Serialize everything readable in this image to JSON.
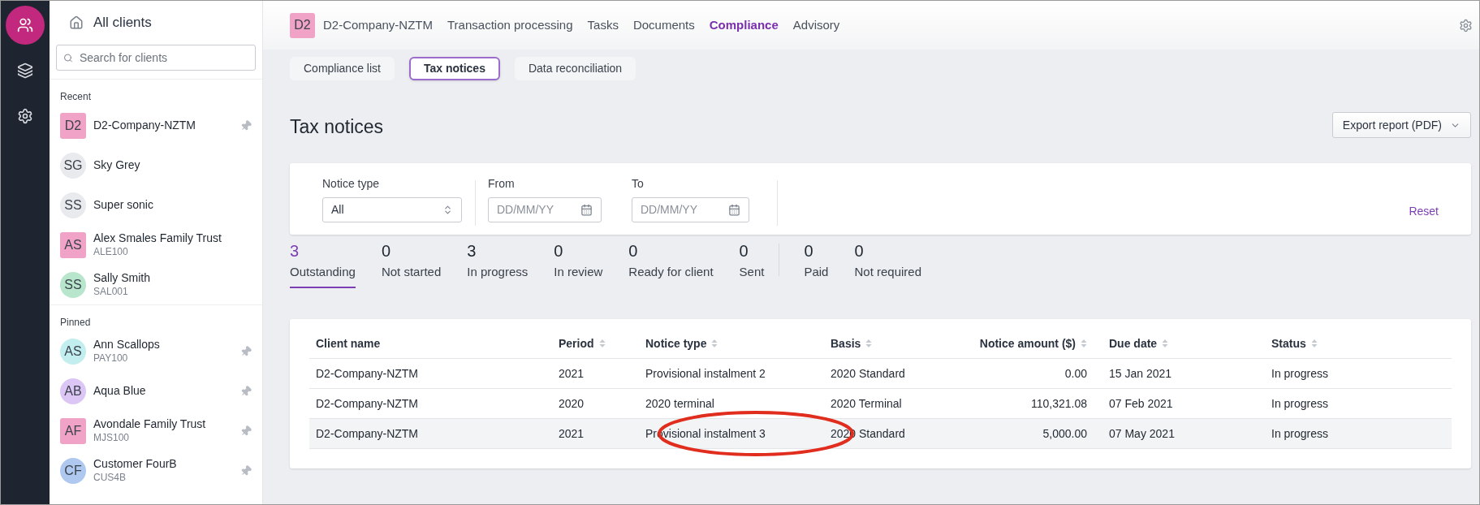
{
  "rail": {
    "items": [
      {
        "selected": true
      },
      {
        "selected": false
      },
      {
        "selected": false
      }
    ]
  },
  "sidebar": {
    "title": "All clients",
    "search": {
      "placeholder": "Search for clients"
    },
    "sections": [
      {
        "title": "Recent",
        "items": [
          {
            "initials": "D2",
            "name": "D2-Company-NZTM",
            "kind": "company",
            "color": "#f0a3c6",
            "pinned": true
          },
          {
            "initials": "SG",
            "name": "Sky Grey",
            "kind": "person",
            "color": "#e9eaed",
            "pinned": false
          },
          {
            "initials": "SS",
            "name": "Super sonic",
            "kind": "person",
            "color": "#e9eaed",
            "pinned": false
          },
          {
            "initials": "AS",
            "name": "Alex Smales Family Trust",
            "code": "ALE100",
            "kind": "company",
            "color": "#f0a3c6",
            "pinned": false
          },
          {
            "initials": "SS",
            "name": "Sally Smith",
            "code": "SAL001",
            "kind": "person",
            "color": "#b8e6cc",
            "pinned": false
          }
        ]
      },
      {
        "title": "Pinned",
        "items": [
          {
            "initials": "AS",
            "name": "Ann Scallops",
            "code": "PAY100",
            "kind": "person",
            "color": "#c2eef0",
            "pinned": true
          },
          {
            "initials": "AB",
            "name": "Aqua Blue",
            "kind": "person",
            "color": "#dcc6f5",
            "pinned": true
          },
          {
            "initials": "AF",
            "name": "Avondale Family Trust",
            "code": "MJS100",
            "kind": "company",
            "color": "#f0a3c6",
            "pinned": true
          },
          {
            "initials": "CF",
            "name": "Customer FourB",
            "code": "CUS4B",
            "kind": "person",
            "color": "#afc8f0",
            "pinned": true
          }
        ]
      }
    ]
  },
  "topnav": {
    "client_initials": "D2",
    "client_name": "D2-Company-NZTM",
    "items": [
      {
        "label": "Transaction processing",
        "selected": false
      },
      {
        "label": "Tasks",
        "selected": false
      },
      {
        "label": "Documents",
        "selected": false
      },
      {
        "label": "Compliance",
        "selected": true
      },
      {
        "label": "Advisory",
        "selected": false
      }
    ]
  },
  "subtabs": [
    {
      "label": "Compliance list",
      "selected": false
    },
    {
      "label": "Tax notices",
      "selected": true
    },
    {
      "label": "Data reconciliation",
      "selected": false
    }
  ],
  "page": {
    "title": "Tax notices",
    "export_button": "Export report (PDF)"
  },
  "filters": {
    "notice_type": {
      "label": "Notice type",
      "value": "All"
    },
    "from": {
      "label": "From",
      "placeholder": "DD/MM/YY"
    },
    "to": {
      "label": "To",
      "placeholder": "DD/MM/YY"
    },
    "reset": "Reset"
  },
  "stat_groups": [
    {
      "items": [
        {
          "count": "3",
          "label": "Outstanding",
          "selected": true
        },
        {
          "count": "0",
          "label": "Not started",
          "selected": false
        },
        {
          "count": "3",
          "label": "In progress",
          "selected": false
        },
        {
          "count": "0",
          "label": "In review",
          "selected": false
        },
        {
          "count": "0",
          "label": "Ready for client",
          "selected": false
        },
        {
          "count": "0",
          "label": "Sent",
          "selected": false
        }
      ]
    },
    {
      "items": [
        {
          "count": "0",
          "label": "Paid",
          "selected": false
        },
        {
          "count": "0",
          "label": "Not required",
          "selected": false
        }
      ]
    }
  ],
  "table": {
    "columns": [
      {
        "label": "Client name",
        "sortable": false,
        "numeric": false
      },
      {
        "label": "Period",
        "sortable": true,
        "numeric": false
      },
      {
        "label": "Notice type",
        "sortable": true,
        "numeric": false
      },
      {
        "label": "Basis",
        "sortable": true,
        "numeric": false
      },
      {
        "label": "Notice amount ($)",
        "sortable": true,
        "numeric": true
      },
      {
        "label": "Due date",
        "sortable": true,
        "numeric": false
      },
      {
        "label": "Status",
        "sortable": true,
        "numeric": false
      }
    ],
    "rows": [
      {
        "cells": [
          "D2-Company-NZTM",
          "2021",
          "Provisional instalment 2",
          "2020 Standard",
          "0.00",
          "15 Jan 2021",
          "In progress"
        ],
        "hovered": false,
        "circled": false
      },
      {
        "cells": [
          "D2-Company-NZTM",
          "2020",
          "2020 terminal",
          "2020 Terminal",
          "110,321.08",
          "07 Feb 2021",
          "In progress"
        ],
        "hovered": false,
        "circled": false
      },
      {
        "cells": [
          "D2-Company-NZTM",
          "2021",
          "Provisional instalment 3",
          "2020 Standard",
          "5,000.00",
          "07 May 2021",
          "In progress"
        ],
        "hovered": true,
        "circled": true
      }
    ]
  }
}
